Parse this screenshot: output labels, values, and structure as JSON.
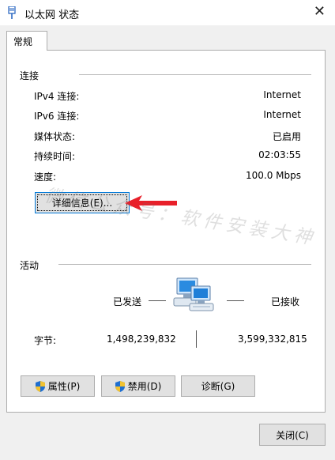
{
  "window": {
    "title": "以太网 状态",
    "close_glyph": "✕"
  },
  "tabs": [
    {
      "label": "常规"
    }
  ],
  "connection": {
    "section_title": "连接",
    "rows": [
      {
        "label": "IPv4 连接:",
        "value": "Internet"
      },
      {
        "label": "IPv6 连接:",
        "value": "Internet"
      },
      {
        "label": "媒体状态:",
        "value": "已启用"
      },
      {
        "label": "持续时间:",
        "value": "02:03:55"
      },
      {
        "label": "速度:",
        "value": "100.0 Mbps"
      }
    ],
    "details_button": "详细信息(E)..."
  },
  "activity": {
    "section_title": "活动",
    "sent_label": "已发送",
    "received_label": "已接收",
    "bytes_label": "字节:",
    "bytes_sent": "1,498,239,832",
    "bytes_received": "3,599,332,815",
    "network_icon": "network-computers-icon"
  },
  "buttons": {
    "properties": "属性(P)",
    "disable": "禁用(D)",
    "diagnose": "诊断(G)",
    "close": "关闭(C)"
  },
  "watermark": {
    "text": "微信公众号：软件安装大神"
  },
  "colors": {
    "focus_border": "#0078d7",
    "annotation_arrow": "#e8202a",
    "shield_blue": "#1f6fd1",
    "shield_yellow": "#f2c230"
  }
}
